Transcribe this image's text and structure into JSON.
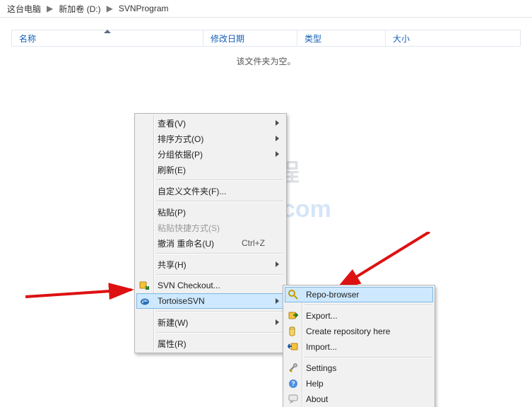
{
  "breadcrumb": {
    "items": [
      "这台电脑",
      "新加卷 (D:)",
      "SVNProgram"
    ]
  },
  "columns": {
    "name": "名称",
    "date": "修改日期",
    "type": "类型",
    "size": "大小"
  },
  "empty_folder_msg": "该文件夹为空。",
  "watermark": {
    "line1_cn": "老吴搭建教程",
    "line2_en": "weixiaolive.com"
  },
  "menu": {
    "view": {
      "label": "查看(V)"
    },
    "sort": {
      "label": "排序方式(O)"
    },
    "group": {
      "label": "分组依据(P)"
    },
    "refresh": {
      "label": "刷新(E)"
    },
    "customize": {
      "label": "自定义文件夹(F)..."
    },
    "paste": {
      "label": "粘贴(P)"
    },
    "paste_short": {
      "label": "粘贴快捷方式(S)"
    },
    "undo": {
      "label": "撤消 重命名(U)",
      "hotkey": "Ctrl+Z"
    },
    "share": {
      "label": "共享(H)"
    },
    "svn_checkout": {
      "label": "SVN Checkout..."
    },
    "tortoisesvn": {
      "label": "TortoiseSVN"
    },
    "new": {
      "label": "新建(W)"
    },
    "properties": {
      "label": "属性(R)"
    }
  },
  "submenu": {
    "repo_browser": {
      "label": "Repo-browser"
    },
    "export": {
      "label": "Export..."
    },
    "create_repo": {
      "label": "Create repository here"
    },
    "import": {
      "label": "Import..."
    },
    "settings": {
      "label": "Settings"
    },
    "help": {
      "label": "Help"
    },
    "about": {
      "label": "About"
    }
  }
}
